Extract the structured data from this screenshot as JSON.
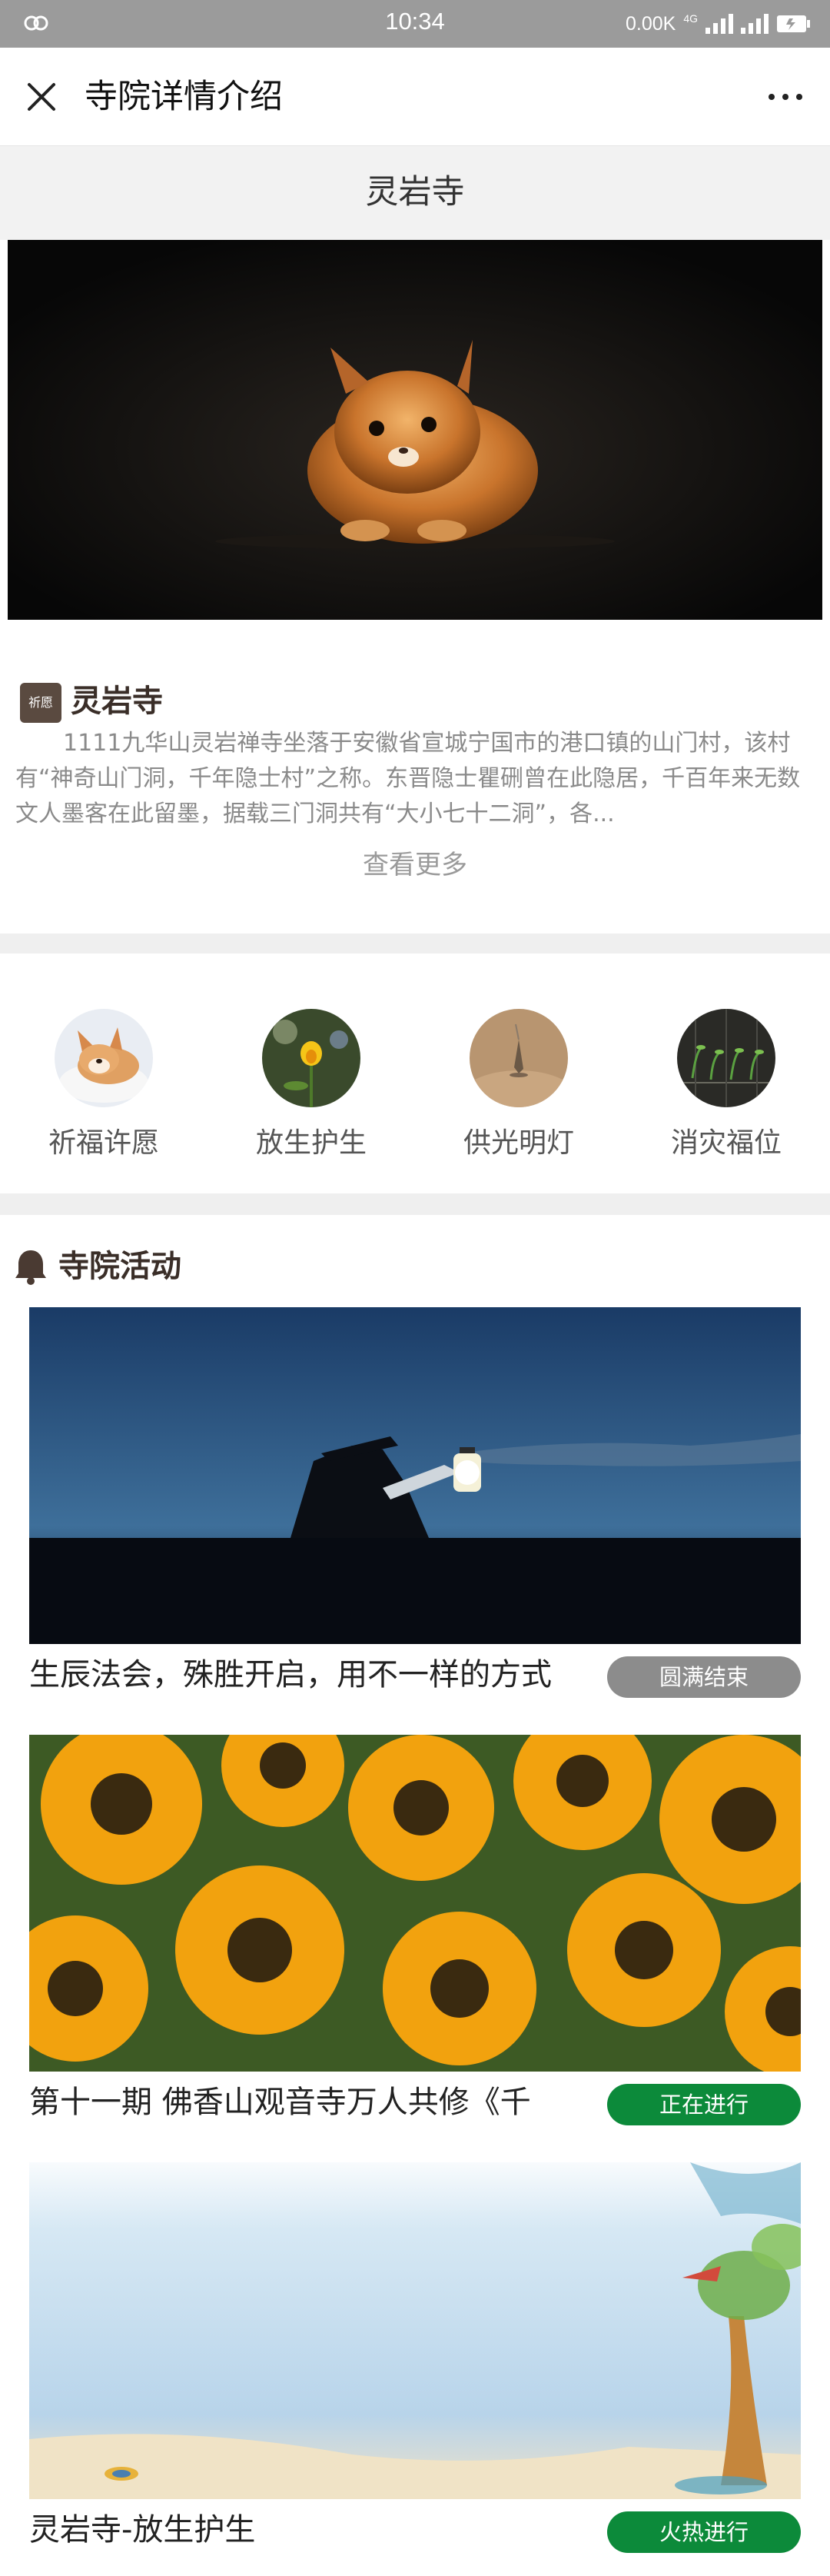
{
  "status_bar": {
    "time": "10:34",
    "speed": "0.00K",
    "network": "4G",
    "battery_icon": "battery-icon",
    "signal_icon": "signal-icon"
  },
  "nav": {
    "title": "寺院详情介绍",
    "close_icon": "close-icon",
    "more_icon": "more-icon"
  },
  "temple": {
    "name": "灵岩寺",
    "badge": "祈愿",
    "intro_title": "灵岩寺",
    "intro_text": "1111九华山灵岩禅寺坐落于安徽省宣城宁国市的港口镇的山门村，该村有“神奇山门洞，千年隐士村”之称。东晋隐士瞿硎曾在此隐居，千百年来无数文人墨客在此留墨，据载三门洞共有“大小七十二洞”，各...",
    "more_label": "查看更多"
  },
  "features": [
    {
      "label": "祈福许愿",
      "icon": "dog-image-icon"
    },
    {
      "label": "放生护生",
      "icon": "flower-image-icon"
    },
    {
      "label": "供光明灯",
      "icon": "lamp-image-icon"
    },
    {
      "label": "消灾福位",
      "icon": "sprout-image-icon"
    }
  ],
  "activities": {
    "heading": "寺院活动",
    "items": [
      {
        "title": "生辰法会，殊胜开启，用不一样的方式",
        "status": "圆满结束",
        "status_color": "#8c8c8c"
      },
      {
        "title": "第十一期 佛香山观音寺万人共修《千",
        "status": "正在进行",
        "status_color": "#0c8a3a"
      },
      {
        "title": "灵岩寺-放生护生",
        "status": "火热进行",
        "status_color": "#0c8a3a"
      }
    ]
  },
  "colors": {
    "accent_brown": "#3a2e28",
    "status_gray": "#8c8c8c",
    "status_green": "#0c8a3a"
  }
}
